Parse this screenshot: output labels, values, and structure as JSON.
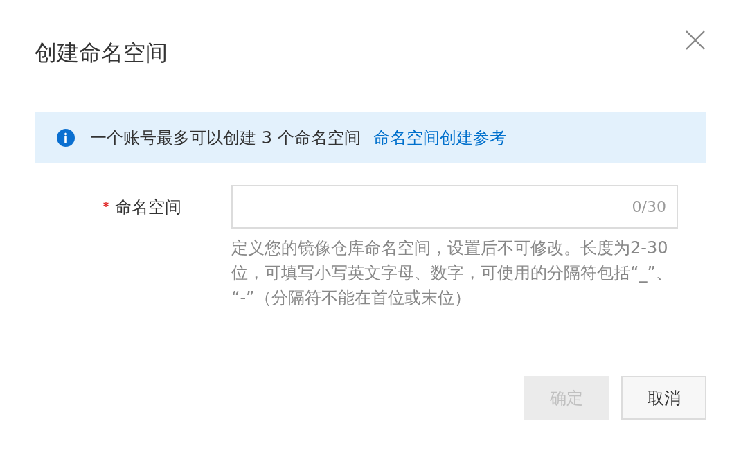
{
  "dialog": {
    "title": "创建命名空间"
  },
  "notice": {
    "text": "一个账号最多可以创建 3 个命名空间",
    "link": "命名空间创建参考"
  },
  "form": {
    "fields": [
      {
        "label": "命名空间",
        "required": true,
        "counter": "0/30",
        "help": "定义您的镜像仓库命名空间，设置后不可修改。长度为2-30位，可填写小写英文字母、数字，可使用的分隔符包括“_”、“-”（分隔符不能在首位或末位）"
      }
    ]
  },
  "buttons": [
    {
      "label": "确定",
      "kind": "primary",
      "disabled": true
    },
    {
      "label": "取消",
      "kind": "secondary",
      "disabled": false
    }
  ]
}
